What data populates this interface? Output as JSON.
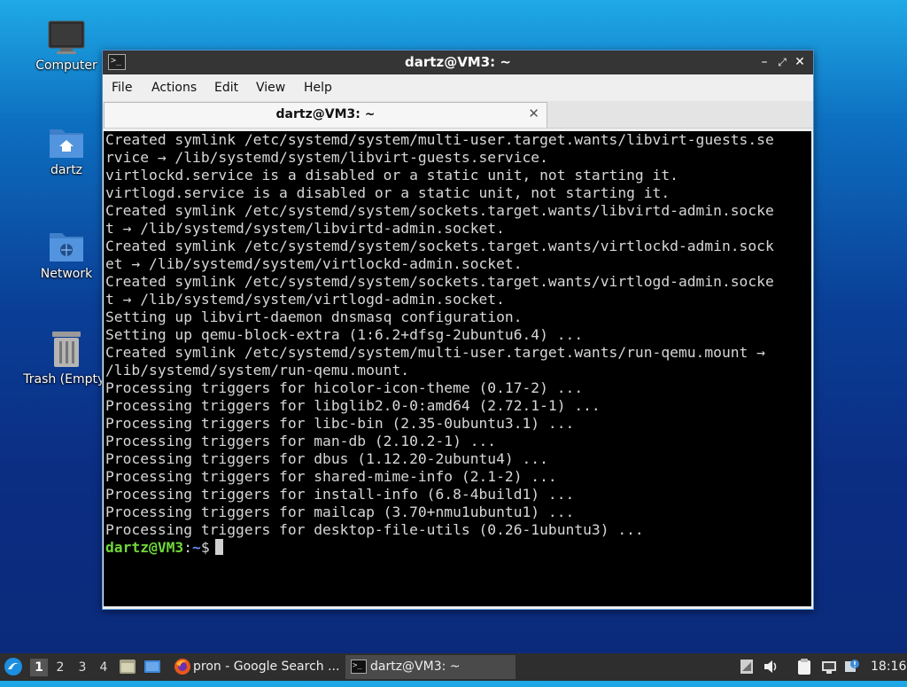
{
  "desktop": {
    "icons": [
      {
        "label": "Computer"
      },
      {
        "label": "dartz"
      },
      {
        "label": "Network"
      },
      {
        "label": "Trash (Empty)"
      }
    ]
  },
  "window": {
    "title": "dartz@VM3: ~",
    "menu": [
      "File",
      "Actions",
      "Edit",
      "View",
      "Help"
    ],
    "tab_label": "dartz@VM3: ~",
    "terminal_lines": [
      "Created symlink /etc/systemd/system/multi-user.target.wants/libvirt-guests.se",
      "rvice → /lib/systemd/system/libvirt-guests.service.",
      "virtlockd.service is a disabled or a static unit, not starting it.",
      "virtlogd.service is a disabled or a static unit, not starting it.",
      "Created symlink /etc/systemd/system/sockets.target.wants/libvirtd-admin.socke",
      "t → /lib/systemd/system/libvirtd-admin.socket.",
      "Created symlink /etc/systemd/system/sockets.target.wants/virtlockd-admin.sock",
      "et → /lib/systemd/system/virtlockd-admin.socket.",
      "Created symlink /etc/systemd/system/sockets.target.wants/virtlogd-admin.socke",
      "t → /lib/systemd/system/virtlogd-admin.socket.",
      "Setting up libvirt-daemon dnsmasq configuration.",
      "Setting up qemu-block-extra (1:6.2+dfsg-2ubuntu6.4) ...",
      "Created symlink /etc/systemd/system/multi-user.target.wants/run-qemu.mount →",
      "/lib/systemd/system/run-qemu.mount.",
      "Processing triggers for hicolor-icon-theme (0.17-2) ...",
      "Processing triggers for libglib2.0-0:amd64 (2.72.1-1) ...",
      "Processing triggers for libc-bin (2.35-0ubuntu3.1) ...",
      "Processing triggers for man-db (2.10.2-1) ...",
      "Processing triggers for dbus (1.12.20-2ubuntu4) ...",
      "Processing triggers for shared-mime-info (2.1-2) ...",
      "Processing triggers for install-info (6.8-4build1) ...",
      "Processing triggers for mailcap (3.70+nmu1ubuntu1) ...",
      "Processing triggers for desktop-file-utils (0.26-1ubuntu3) ..."
    ],
    "prompt": {
      "user": "dartz@VM3",
      "sep": ":",
      "path": "~",
      "symbol": "$"
    }
  },
  "taskbar": {
    "workspaces": [
      "1",
      "2",
      "3",
      "4"
    ],
    "tasks": [
      {
        "label": "pron - Google Search ..."
      },
      {
        "label": "dartz@VM3: ~"
      }
    ],
    "clock": "18:16"
  }
}
